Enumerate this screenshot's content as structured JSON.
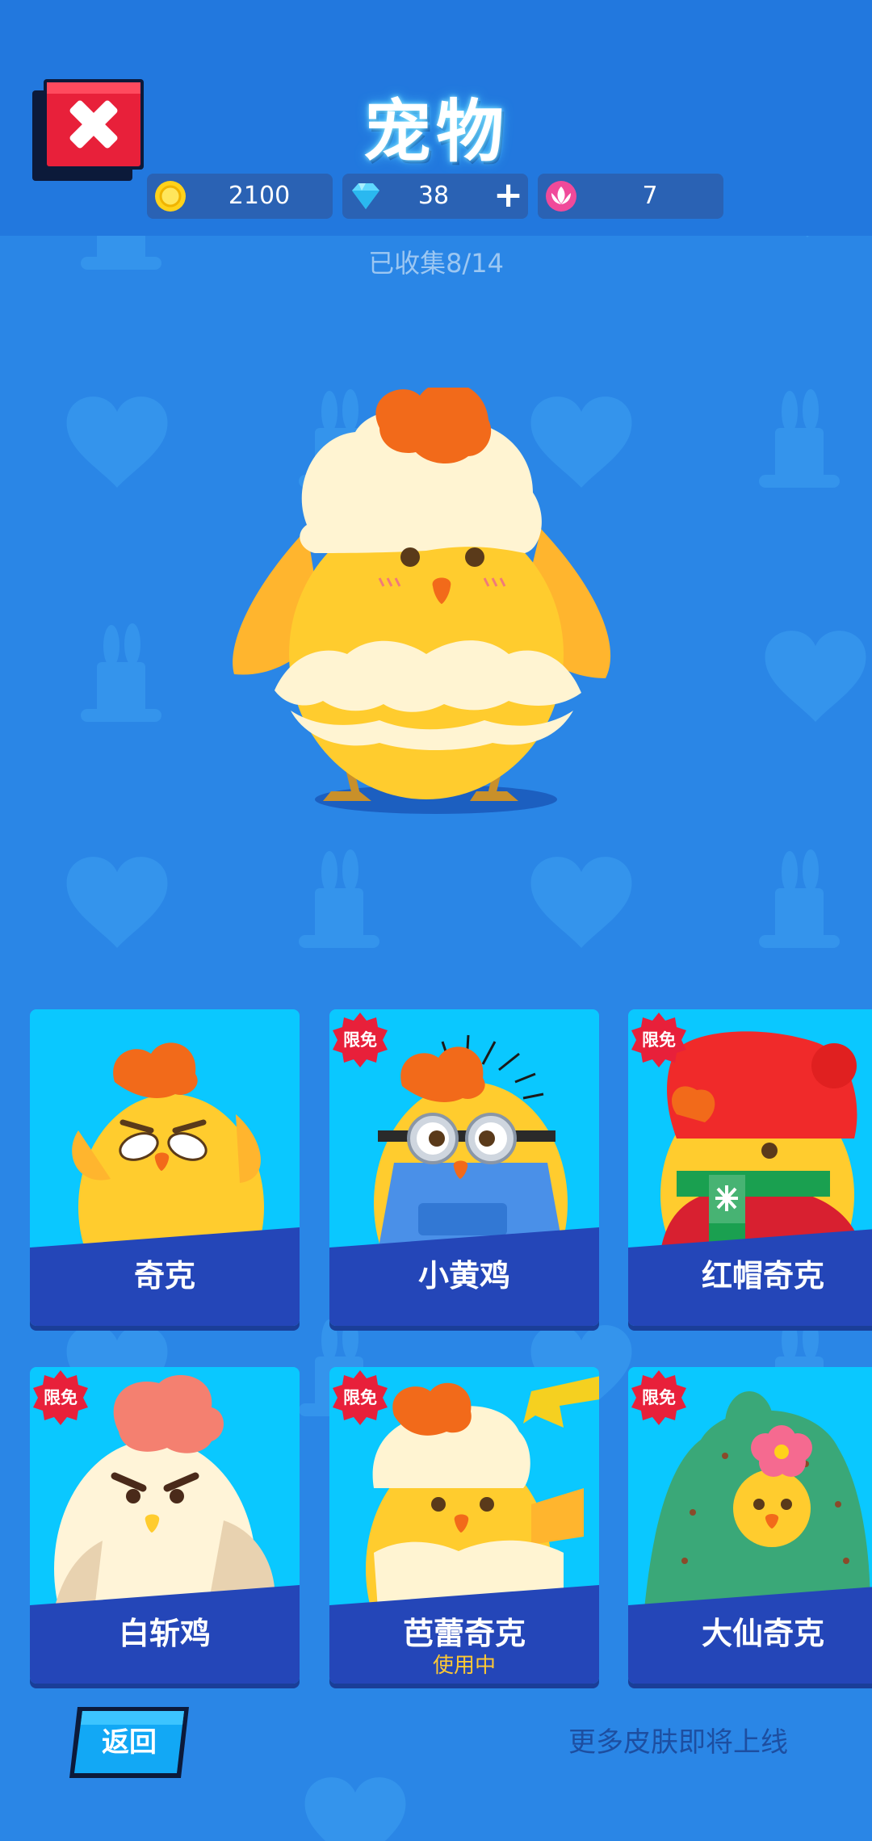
{
  "header": {
    "title": "宠物",
    "currencies": [
      {
        "icon": "coin-icon",
        "value": "2100"
      },
      {
        "icon": "diamond-icon",
        "value": "38",
        "add_label": "+"
      },
      {
        "icon": "lotus-icon",
        "value": "7"
      }
    ]
  },
  "collection": {
    "collected_label": "已收集8/14"
  },
  "featured_pet": {
    "name": "芭蕾奇克"
  },
  "pets": [
    {
      "name": "奇克",
      "badge": ""
    },
    {
      "name": "小黄鸡",
      "badge": "限免"
    },
    {
      "name": "红帽奇克",
      "badge": "限免"
    },
    {
      "name": "白斩鸡",
      "badge": "限免"
    },
    {
      "name": "芭蕾奇克",
      "badge": "限免",
      "status": "使用中"
    },
    {
      "name": "大仙奇克",
      "badge": "限免"
    }
  ],
  "footer": {
    "back_label": "返回",
    "more_label": "更多皮肤即将上线"
  },
  "colors": {
    "background": "#2a86e6",
    "card": "#0ac8ff",
    "card_band": "#2446b8",
    "badge": "#e8203a",
    "close_button": "#e8203a",
    "in_use": "#ffc933"
  }
}
